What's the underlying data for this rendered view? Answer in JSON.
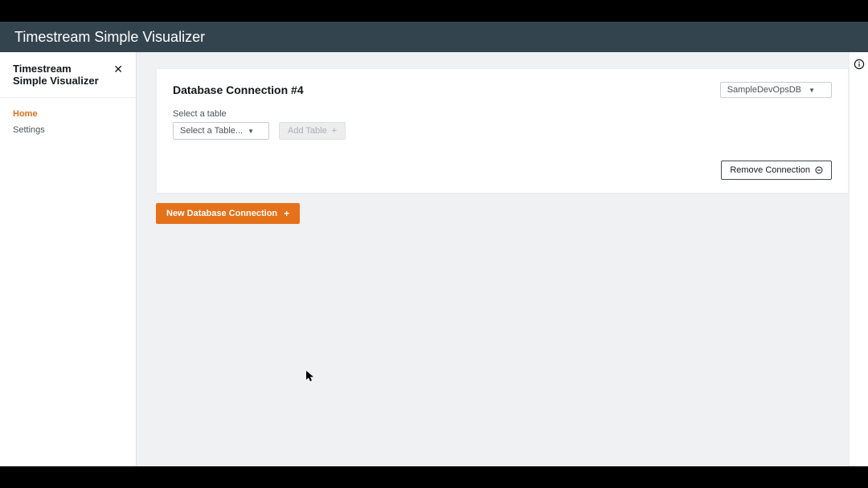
{
  "header": {
    "title": "Timestream Simple Visualizer"
  },
  "sidebar": {
    "title": "Timestream Simple Visualizer",
    "items": [
      {
        "label": "Home",
        "active": true
      },
      {
        "label": "Settings",
        "active": false
      }
    ]
  },
  "connection": {
    "card_title": "Database Connection #4",
    "db_selected": "SampleDevOpsDB",
    "select_table_label": "Select a table",
    "table_select_placeholder": "Select a Table...",
    "add_table_label": "Add Table",
    "remove_label": "Remove Connection"
  },
  "actions": {
    "new_connection_label": "New Database Connection"
  }
}
